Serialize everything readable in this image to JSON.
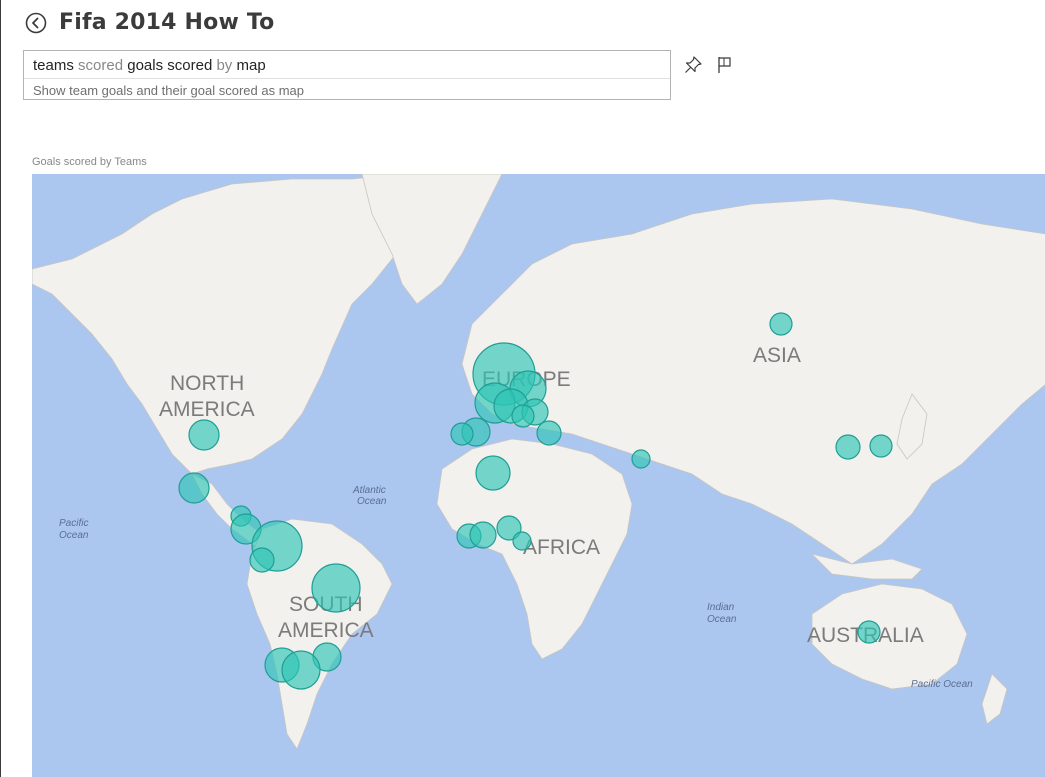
{
  "page": {
    "title": "Fifa 2014 How To"
  },
  "qa": {
    "query_terms": [
      {
        "text": "teams",
        "kind": "term"
      },
      {
        "text": "scored",
        "kind": "stop"
      },
      {
        "text": "goals scored",
        "kind": "term"
      },
      {
        "text": "by",
        "kind": "stop"
      },
      {
        "text": "map",
        "kind": "term"
      }
    ],
    "restatement": "Show team goals and their goal scored as map"
  },
  "toolbar": {
    "icons": [
      "pin-icon",
      "flag-icon"
    ]
  },
  "visual": {
    "title": "Goals scored by Teams",
    "map_labels": {
      "north_america_1": "NORTH",
      "north_america_2": "AMERICA",
      "south_america_1": "SOUTH",
      "south_america_2": "AMERICA",
      "europe": "EUROPE",
      "asia": "ASIA",
      "africa": "AFRICA",
      "australia": "AUSTRALIA",
      "atlantic_1": "Atlantic",
      "atlantic_2": "Ocean",
      "pacific_w_1": "Pacific",
      "pacific_w_2": "Ocean",
      "indian_1": "Indian",
      "indian_2": "Ocean",
      "pacific_e": "Pacific Ocean"
    }
  },
  "colors": {
    "ocean": "#abc6ef",
    "land": "#f2f1ee",
    "bubble_fill": "#2ec4b6",
    "bubble_stroke": "#1f9e93"
  }
}
